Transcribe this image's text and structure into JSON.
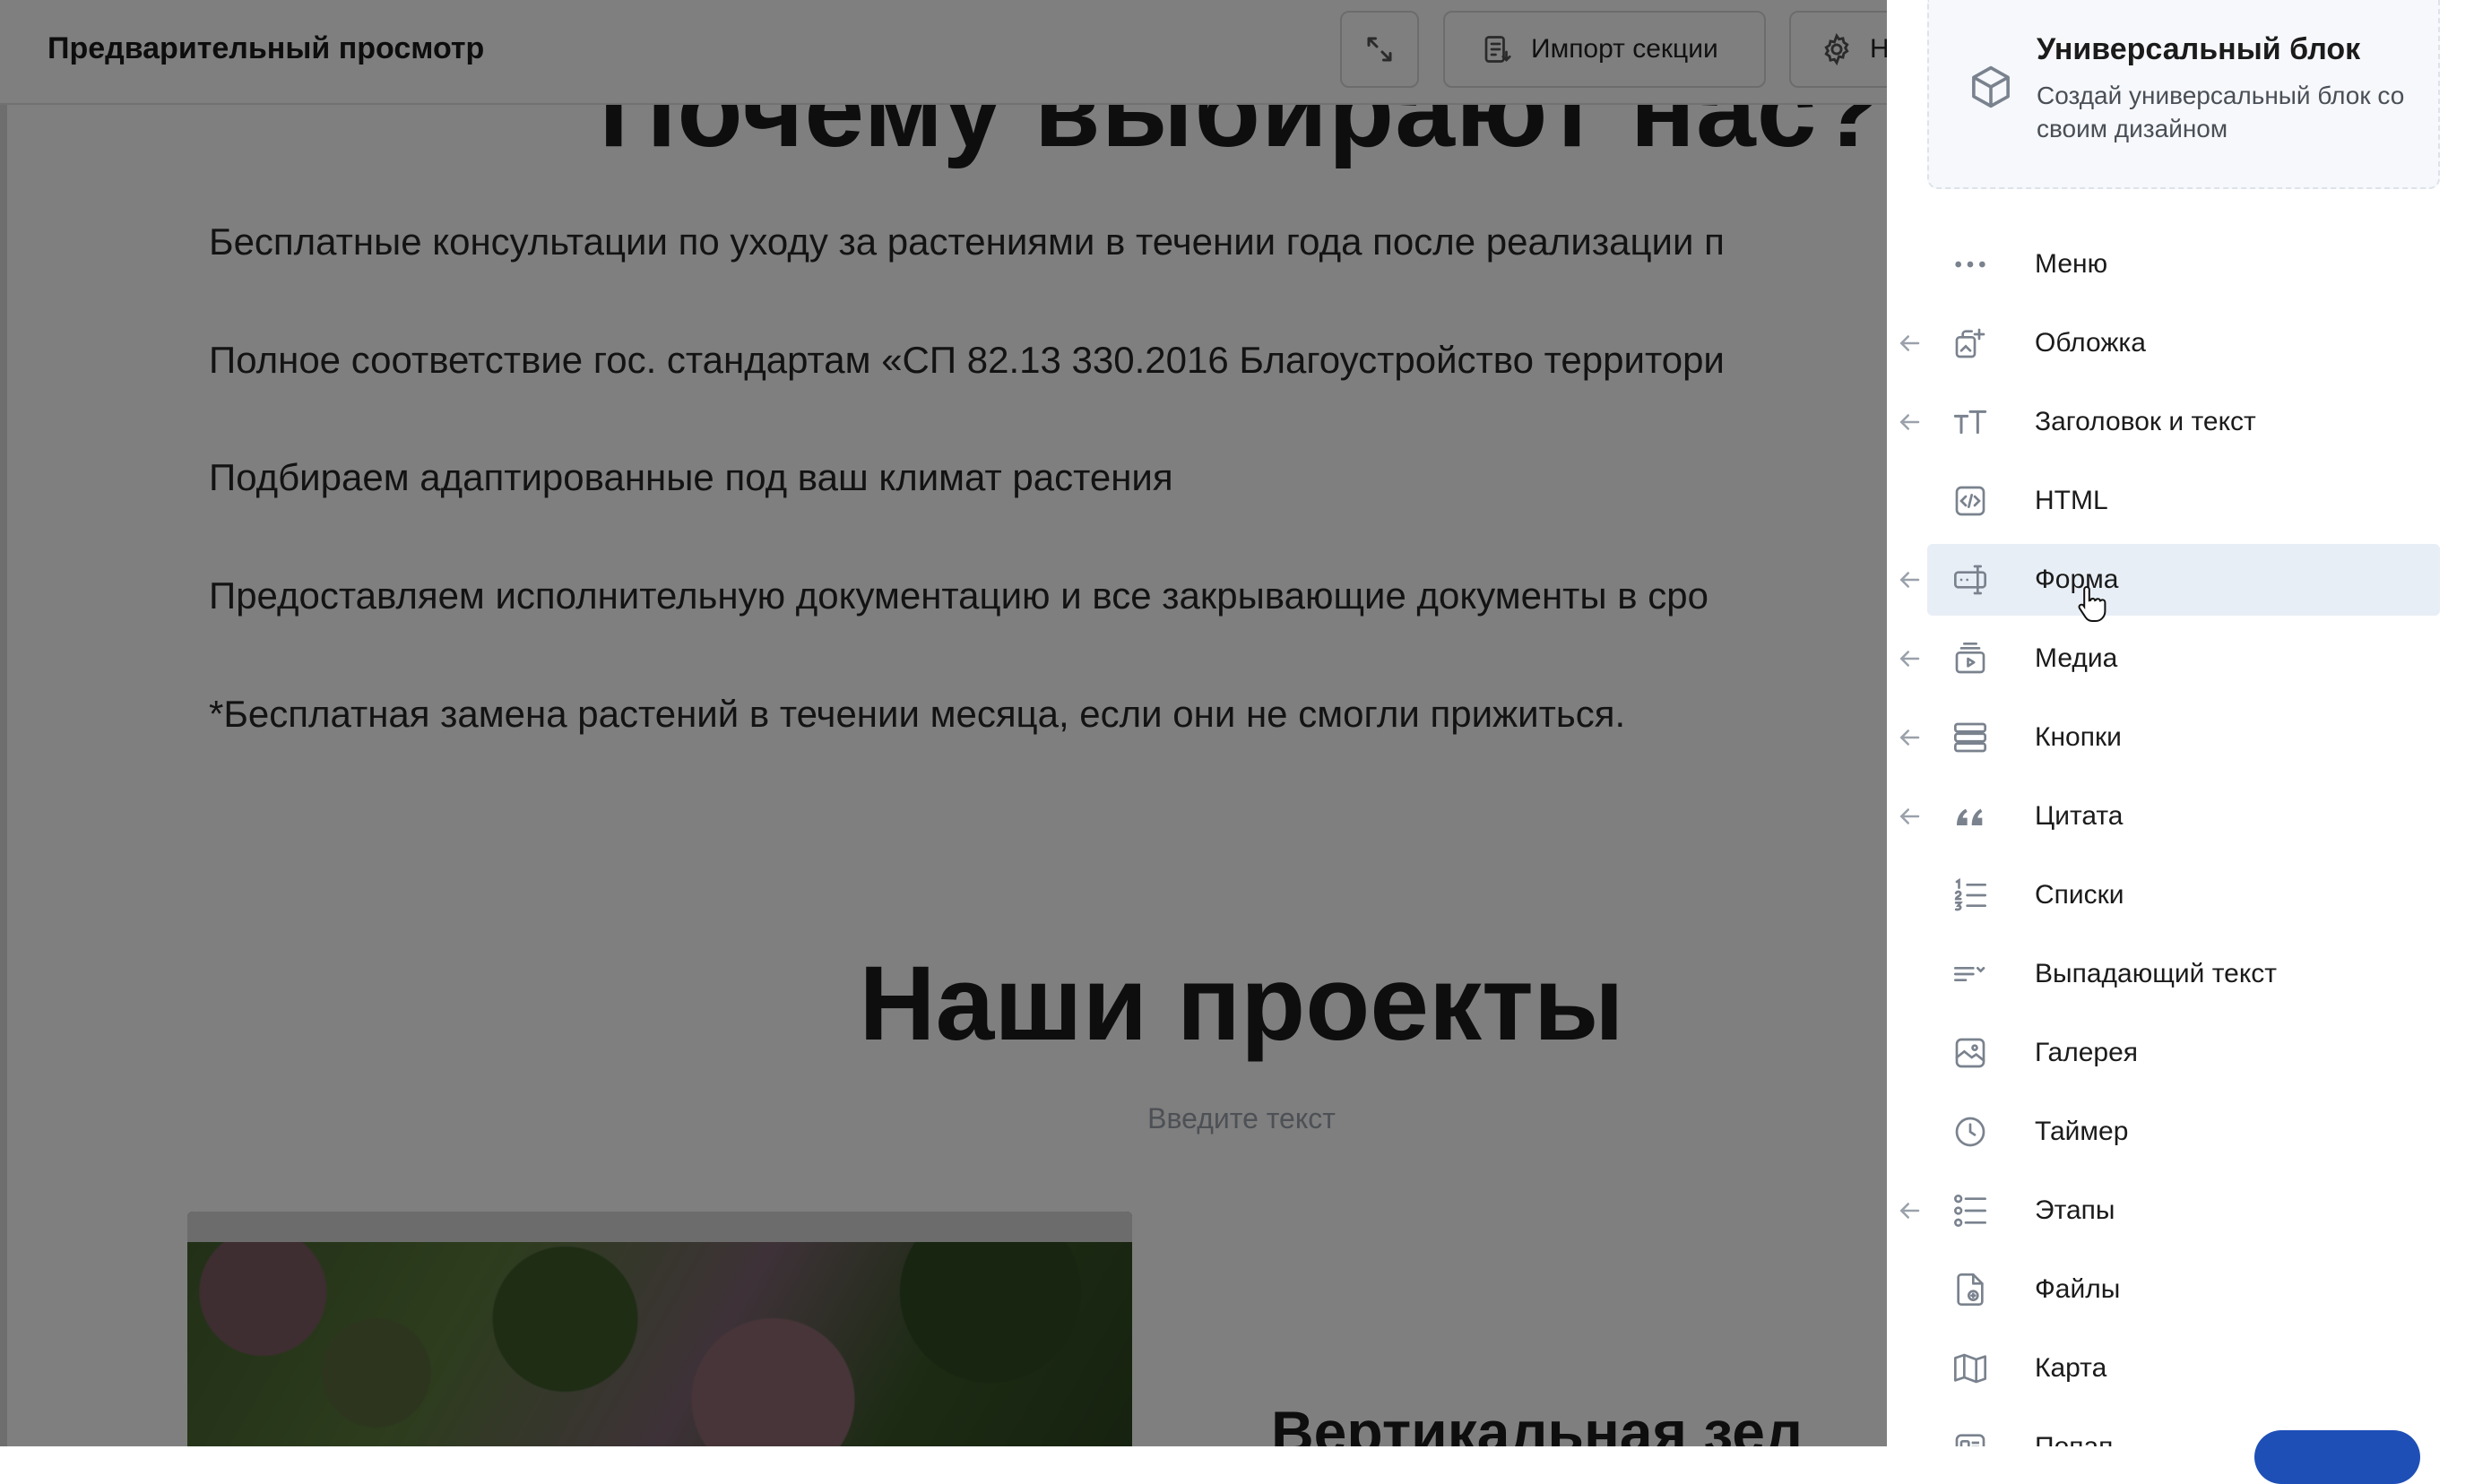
{
  "topbar": {
    "title": "Предварительный просмотр",
    "import_label": "Импорт секции",
    "settings_label": "Н"
  },
  "preview": {
    "cut_heading": "Почему выбирают нас?",
    "paragraphs": [
      "Бесплатные консультации по уходу за растениями в течении года после реализации п",
      "Полное соответствие гос. стандартам «СП 82.13 330.2016 Благоустройство территори",
      "Подбираем адаптированные под ваш климат растения",
      "Предоставляем исполнительную документацию и все закрывающие документы в сро",
      "*Бесплатная замена растений в течении месяца, если они не смогли прижиться."
    ],
    "projects_heading": "Наши проекты",
    "projects_subtitle": "Введите текст",
    "project_title": "Вертикальная зел"
  },
  "sidebar": {
    "universal_title": "Универсальный блок",
    "universal_desc": "Создай универсальный блок со своим дизайном",
    "items": [
      {
        "label": "Меню",
        "icon": "dots-icon",
        "arrow": false
      },
      {
        "label": "Обложка",
        "icon": "cover-icon",
        "arrow": true
      },
      {
        "label": "Заголовок и текст",
        "icon": "text-icon",
        "arrow": true
      },
      {
        "label": "HTML",
        "icon": "code-icon",
        "arrow": false
      },
      {
        "label": "Форма",
        "icon": "form-icon",
        "arrow": true,
        "active": true
      },
      {
        "label": "Медиа",
        "icon": "media-icon",
        "arrow": true
      },
      {
        "label": "Кнопки",
        "icon": "buttons-icon",
        "arrow": true
      },
      {
        "label": "Цитата",
        "icon": "quote-icon",
        "arrow": true
      },
      {
        "label": "Списки",
        "icon": "list-icon",
        "arrow": false
      },
      {
        "label": "Выпадающий текст",
        "icon": "dropdown-text-icon",
        "arrow": false
      },
      {
        "label": "Галерея",
        "icon": "gallery-icon",
        "arrow": false
      },
      {
        "label": "Таймер",
        "icon": "clock-icon",
        "arrow": false
      },
      {
        "label": "Этапы",
        "icon": "steps-icon",
        "arrow": true
      },
      {
        "label": "Файлы",
        "icon": "file-icon",
        "arrow": false
      },
      {
        "label": "Карта",
        "icon": "map-icon",
        "arrow": false
      },
      {
        "label": "Попап",
        "icon": "popup-icon",
        "arrow": false
      }
    ]
  },
  "colors": {
    "active_item_bg": "#e8eef6",
    "accent": "#1e4fb7",
    "icon": "#7a828e"
  }
}
